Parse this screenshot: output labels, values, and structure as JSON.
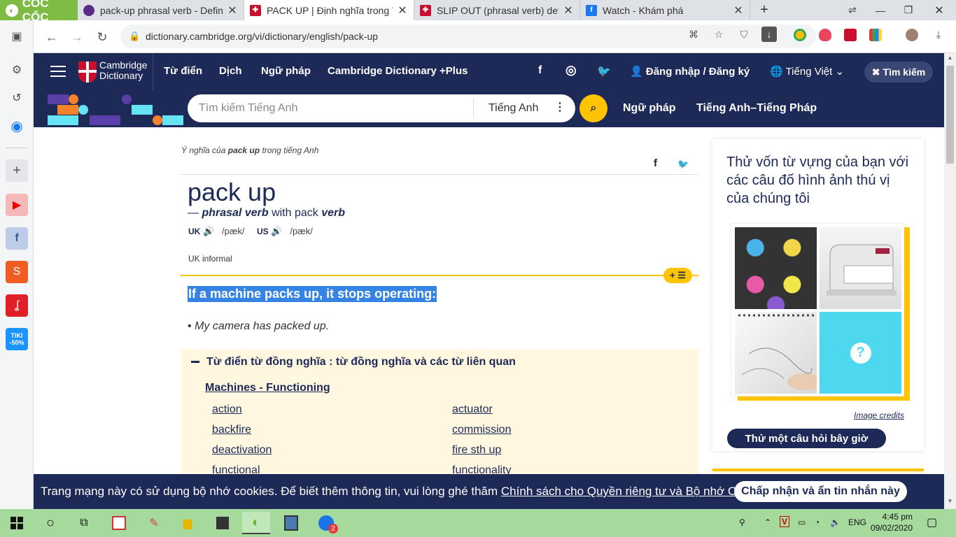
{
  "browser": {
    "brand": "CỐC CỐC",
    "tabs": [
      {
        "title": "pack-up phrasal verb - Definit",
        "fav_color": "#5b2c86"
      },
      {
        "title": "PACK UP | Định nghĩa trong T",
        "fav_color": "#c8102e"
      },
      {
        "title": "SLIP OUT (phrasal verb) defin",
        "fav_color": "#c8102e"
      },
      {
        "title": "Watch - Khám phá",
        "fav_color": "#1877f2"
      }
    ],
    "new_tab": "+",
    "url": "dictionary.cambridge.org/vi/dictionary/english/pack-up"
  },
  "header": {
    "logo_line1": "Cambridge",
    "logo_line2": "Dictionary",
    "nav": [
      "Từ điển",
      "Dịch",
      "Ngữ pháp",
      "Cambridge Dictionary +Plus"
    ],
    "login": "Đăng nhập / Đăng ký",
    "language": "Tiếng Việt",
    "search_btn": "Tìm kiếm"
  },
  "search": {
    "placeholder": "Tìm kiếm Tiếng Anh",
    "lang": "Tiếng Anh",
    "links": [
      "Ngữ pháp",
      "Tiếng Anh–Tiếng Pháp"
    ]
  },
  "entry": {
    "breadcrumb_pre": "Ý nghĩa của",
    "breadcrumb_word": "pack up",
    "breadcrumb_post": "trong tiếng Anh",
    "headword": "pack up",
    "pos_dash": "—",
    "pos_phrasal": "phrasal verb",
    "pos_with": "with pack",
    "pos_verb": "verb",
    "uk_label": "UK",
    "uk_ipa": "/pæk/",
    "us_label": "US",
    "us_ipa": "/pæk/",
    "register": "UK informal",
    "plus_btn": "+ ☰",
    "definition": "If a machine packs up, it stops operating:",
    "example_bullet": "•",
    "example": "My camera has packed up."
  },
  "thesaurus": {
    "title": "Từ điển từ đồng nghĩa : từ đồng nghĩa và các từ liên quan",
    "subtitle": "Machines - Functioning",
    "left": [
      "action",
      "backfire",
      "deactivation",
      "functional"
    ],
    "right": [
      "actuator",
      "commission",
      "fire sth up",
      "functionality"
    ]
  },
  "quiz": {
    "title": "Thử vốn từ vựng của bạn với các câu đố hình ảnh thú vị của chúng tôi",
    "credits": "Image credits",
    "button": "Thử một câu hỏi bây giờ"
  },
  "cookie": {
    "text": "Trang mạng này có sử dụng bộ nhớ cookies. Để biết thêm thông tin, vui lòng ghé thăm",
    "link": "Chính sách cho Quyền riêng tư và Bộ nhớ Cookies",
    "period": ".",
    "button": "Chấp nhận và ẩn tin nhắn này"
  },
  "taskbar": {
    "lang": "ENG",
    "time": "4:45 pm",
    "date": "09/02/2020",
    "badge": "2"
  },
  "colors": {
    "navy": "#1d2a57",
    "yellow": "#fec400",
    "highlight": "#3584e4",
    "coccoc_green": "#7dbb43",
    "taskbar_green": "#a6d99c"
  }
}
